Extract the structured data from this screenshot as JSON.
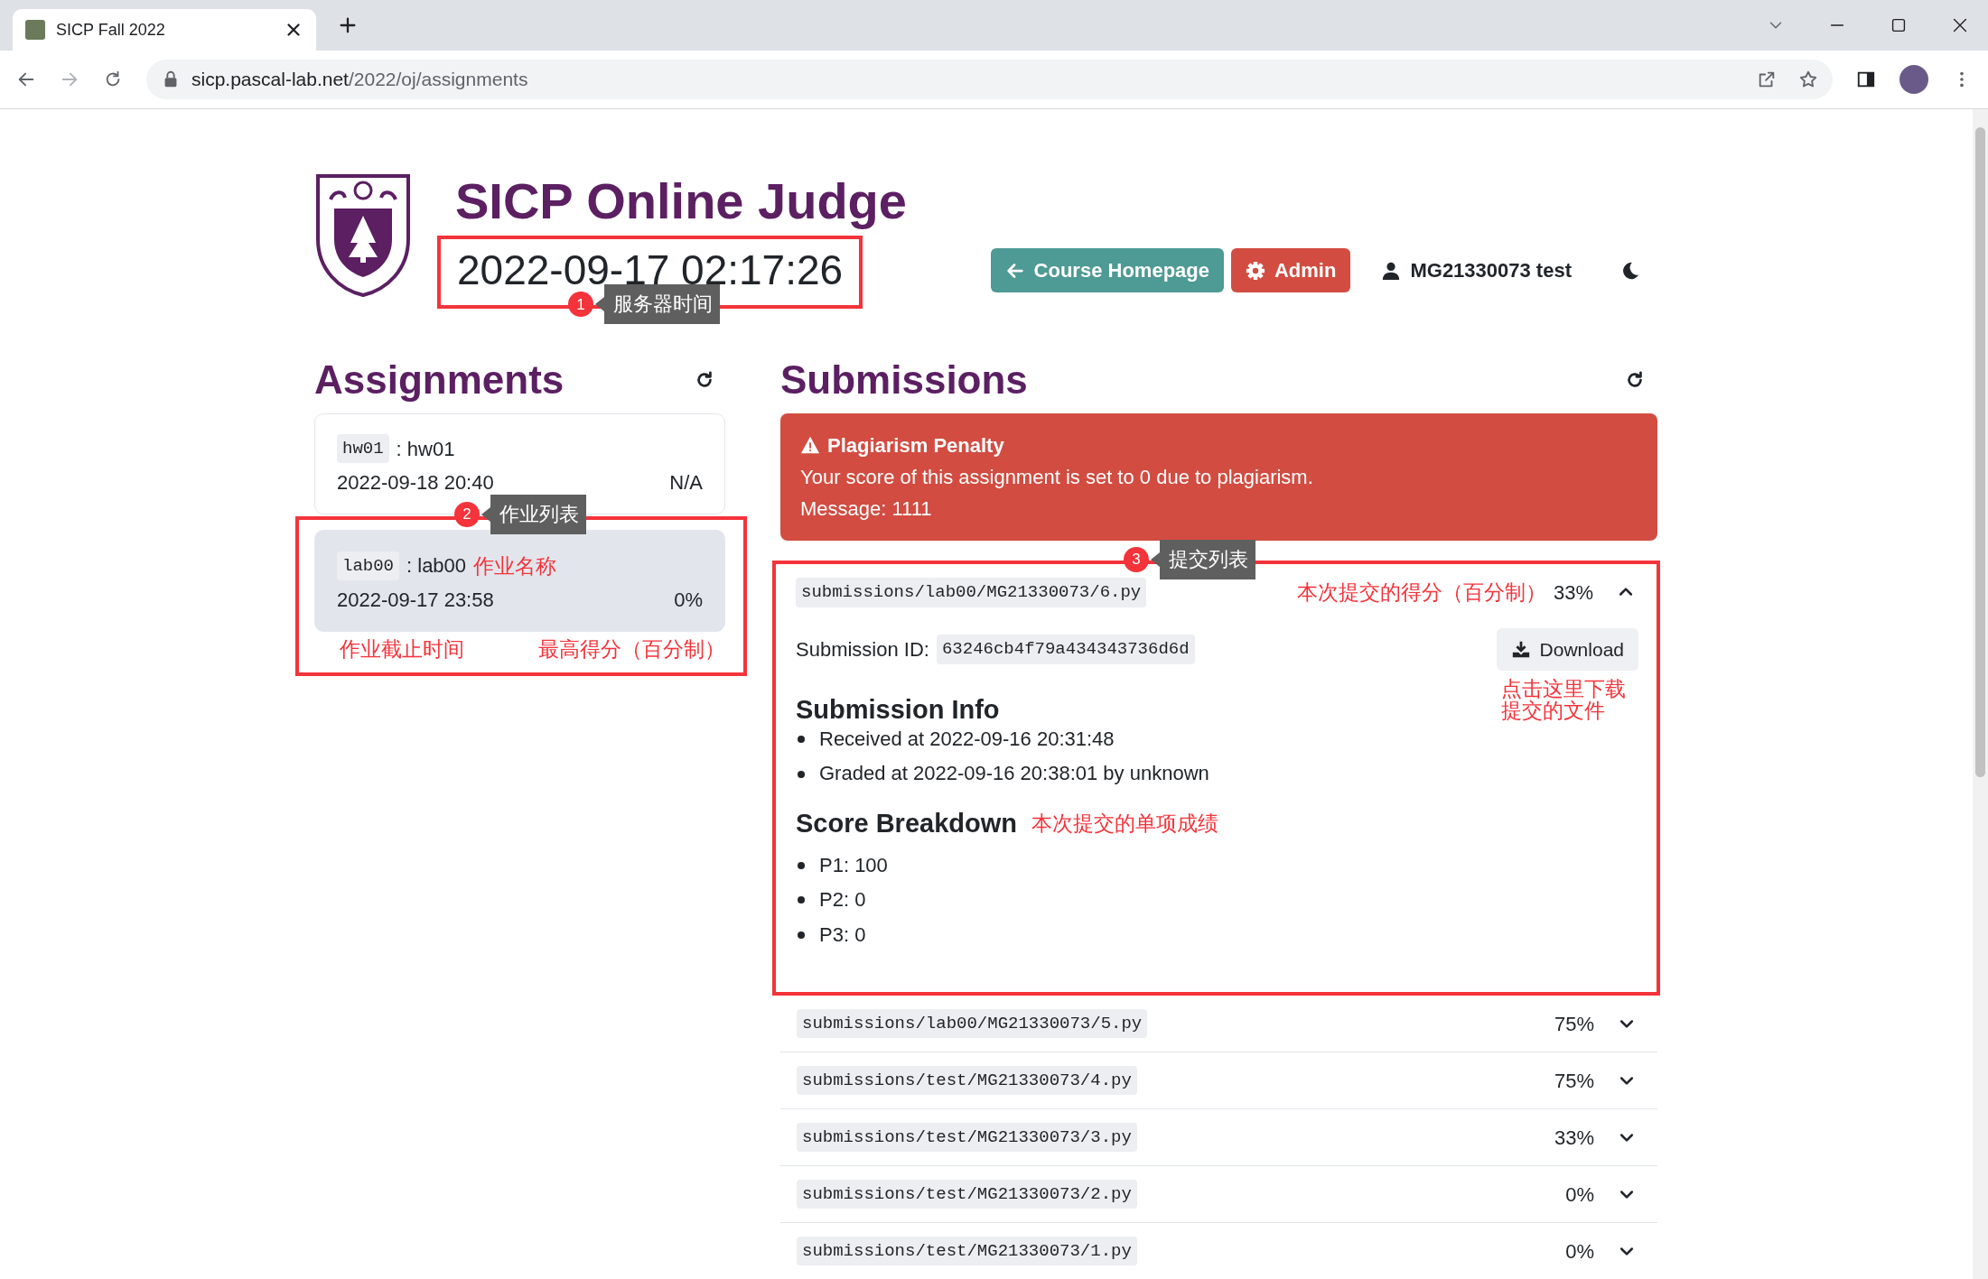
{
  "browser": {
    "tab_title": "SICP Fall 2022",
    "url_host": "sicp.pascal-lab.net",
    "url_path": "/2022/oj/assignments"
  },
  "header": {
    "title": "SICP Online Judge",
    "server_time": "2022-09-17 02:17:26",
    "time_callout": {
      "number": "1",
      "label": "服务器时间"
    },
    "buttons": [
      {
        "label": "Course Homepage",
        "kind": "back"
      },
      {
        "label": "Admin",
        "kind": "admin"
      }
    ],
    "user": "MG21330073 test"
  },
  "assignments": {
    "heading": "Assignments",
    "callout": {
      "number": "2",
      "label": "作业列表"
    },
    "items": [
      {
        "code": "hw01",
        "name": ": hw01",
        "deadline": "2022-09-18 20:40",
        "score": "N/A",
        "selected": false
      },
      {
        "code": "lab00",
        "name": ": lab00",
        "name_note": "作业名称",
        "deadline": "2022-09-17 23:58",
        "score": "0%",
        "selected": true,
        "deadline_note": "作业截止时间",
        "score_note": "最高得分（百分制）"
      }
    ]
  },
  "submissions": {
    "heading": "Submissions",
    "alert": {
      "title": "Plagiarism Penalty",
      "text": "Your score of this assignment is set to 0 due to plagiarism.",
      "message": "Message: 1111"
    },
    "callout": {
      "number": "3",
      "label": "提交列表"
    },
    "items": [
      {
        "path": "submissions/lab00/MG21330073/6.py",
        "score_note": "本次提交的得分（百分制）",
        "score": "33%",
        "expanded": true,
        "details": {
          "id_label": "Submission ID:",
          "id": "63246cb4f79a434343736d6d",
          "download": "Download",
          "download_note": [
            "点击这里下载",
            "提交的文件"
          ],
          "info_heading": "Submission Info",
          "info": [
            "Received at 2022-09-16 20:31:48",
            "Graded at 2022-09-16 20:38:01 by unknown"
          ],
          "breakdown_heading": "Score Breakdown",
          "breakdown_note": "本次提交的单项成绩",
          "breakdown": [
            "P1: 100",
            "P2: 0",
            "P3: 0"
          ]
        }
      },
      {
        "path": "submissions/lab00/MG21330073/5.py",
        "score": "75%",
        "expanded": false
      },
      {
        "path": "submissions/test/MG21330073/4.py",
        "score": "75%",
        "expanded": false
      },
      {
        "path": "submissions/test/MG21330073/3.py",
        "score": "33%",
        "expanded": false
      },
      {
        "path": "submissions/test/MG21330073/2.py",
        "score": "0%",
        "expanded": false
      },
      {
        "path": "submissions/test/MG21330073/1.py",
        "score": "0%",
        "expanded": false
      }
    ]
  }
}
